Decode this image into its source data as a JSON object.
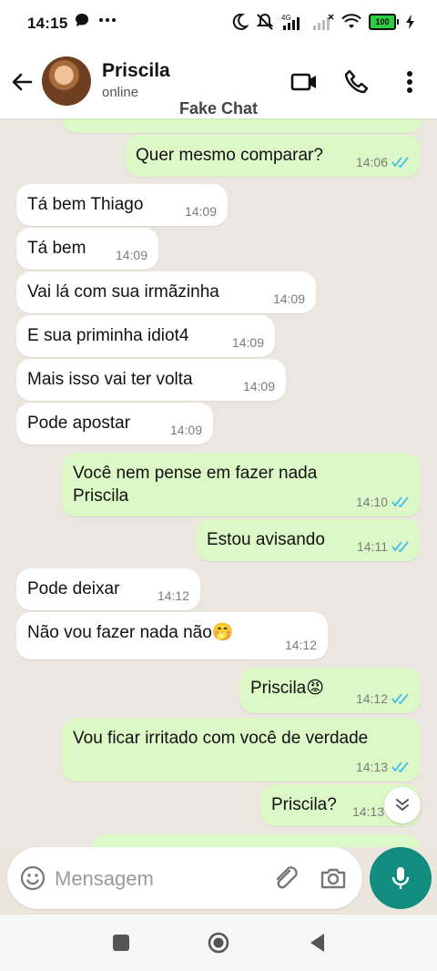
{
  "status_bar": {
    "time": "14:15",
    "battery": "100",
    "network": "4G"
  },
  "header": {
    "contact_name": "Priscila",
    "status": "online",
    "watermark": "Fake Chat"
  },
  "messages": [
    {
      "direction": "out",
      "text": "Quer mesmo comparar?",
      "time": "14:06",
      "read": true
    },
    {
      "direction": "in",
      "text": "Tá bem Thiago",
      "time": "14:09"
    },
    {
      "direction": "in",
      "text": "Tá bem",
      "time": "14:09"
    },
    {
      "direction": "in",
      "text": "Vai lá com sua irmãzinha",
      "time": "14:09"
    },
    {
      "direction": "in",
      "text": "E sua priminha idiot4",
      "time": "14:09"
    },
    {
      "direction": "in",
      "text": "Mais isso vai ter volta",
      "time": "14:09"
    },
    {
      "direction": "in",
      "text": "Pode apostar",
      "time": "14:09"
    },
    {
      "direction": "out",
      "text_line1": "Você nem pense em fazer nada",
      "text_line2": "Priscila",
      "time": "14:10",
      "read": true
    },
    {
      "direction": "out",
      "text": "Estou avisando",
      "time": "14:11",
      "read": true
    },
    {
      "direction": "in",
      "text": "Pode deixar",
      "time": "14:12"
    },
    {
      "direction": "in",
      "text": "Não vou fazer nada não",
      "emoji": "🤭",
      "time": "14:12"
    },
    {
      "direction": "out",
      "text": "Priscila",
      "emoji": "😡",
      "time": "14:12",
      "read": true
    },
    {
      "direction": "out",
      "text": "Vou ficar irritado com você de verdade",
      "time": "14:13",
      "read": true
    },
    {
      "direction": "out",
      "text": "Priscila?",
      "time": "14:13",
      "read": true
    }
  ],
  "input": {
    "placeholder": "Mensagem"
  },
  "colors": {
    "accent": "#128c7e",
    "outgoing": "#dcf8c6",
    "incoming": "#ffffff",
    "read_tick": "#34b7f1"
  }
}
